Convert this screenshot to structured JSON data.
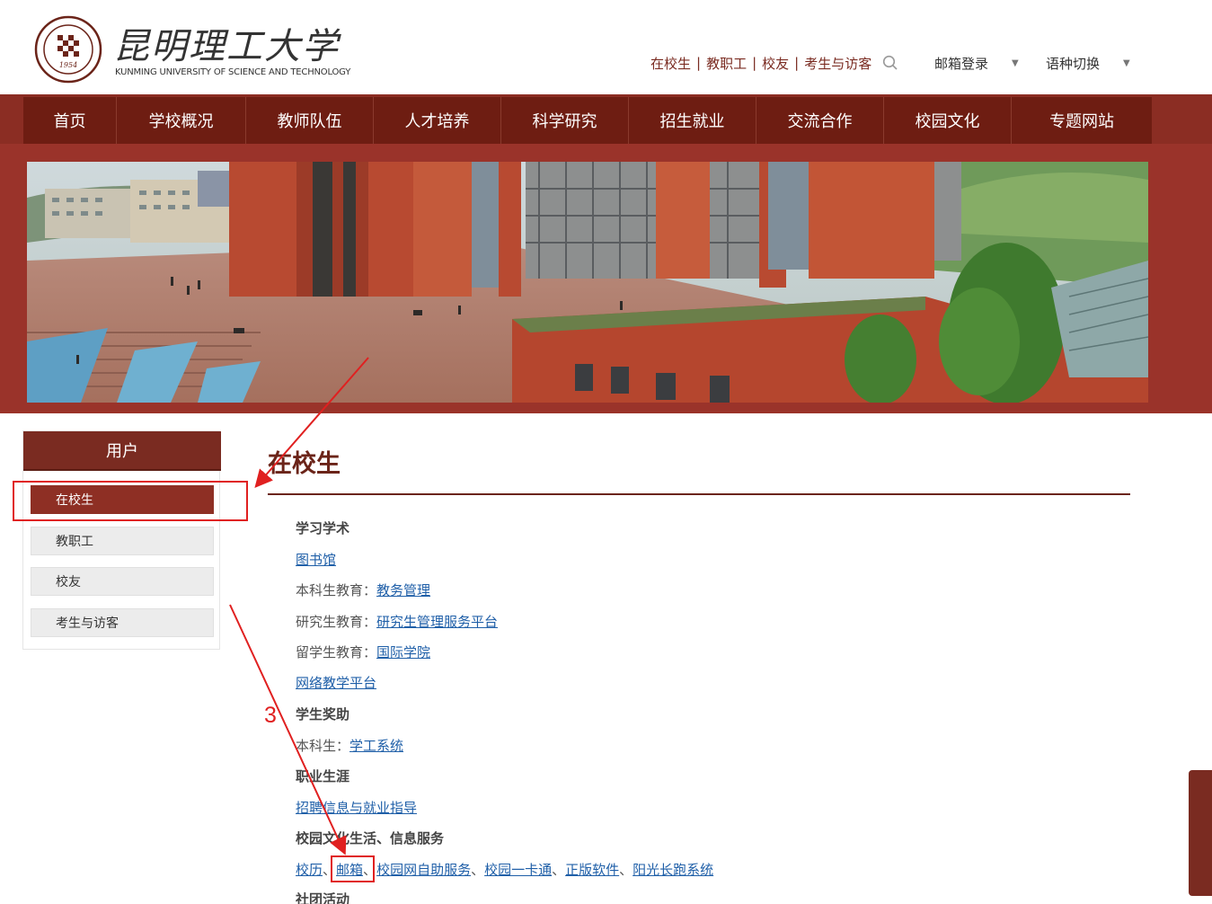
{
  "header": {
    "logo_cn": "昆明理工大学",
    "logo_en": "KUNMING UNIVERSITY OF SCIENCE AND TECHNOLOGY",
    "seal_year": "1954",
    "links": [
      "在校生",
      "教职工",
      "校友",
      "考生与访客"
    ],
    "link_separator": "|",
    "search_icon": "search-icon",
    "mail_login": "邮箱登录",
    "language_switch": "语种切换",
    "caret": "▼"
  },
  "nav": {
    "items": [
      "首页",
      "学校概况",
      "教师队伍",
      "人才培养",
      "科学研究",
      "招生就业",
      "交流合作",
      "校园文化",
      "专题网站"
    ]
  },
  "sidebar": {
    "title": "用户",
    "items": [
      "在校生",
      "教职工",
      "校友",
      "考生与访客"
    ],
    "active_index": 0
  },
  "content": {
    "title": "在校生",
    "sections": {
      "study_head": "学习学术",
      "library": "图书馆",
      "undergrad_label": "本科生教育：",
      "undergrad_link": "教务管理",
      "grad_label": "研究生教育：",
      "grad_link": "研究生管理服务平台",
      "intl_label": "留学生教育：",
      "intl_link": "国际学院",
      "online_link": "网络教学平台",
      "aid_head": "学生奖助",
      "aid_label": "本科生：",
      "aid_link": "学工系统",
      "career_head": "职业生涯",
      "career_link": "招聘信息与就业指导",
      "life_head": "校园文化生活、信息服务",
      "life_links": [
        "校历",
        "邮箱",
        "校园网自助服务",
        "校园一卡通",
        "正版软件",
        "阳光长跑系统"
      ],
      "life_sep": "、",
      "club_head": "社团活动"
    }
  },
  "annotation": {
    "step_number": "3",
    "color": "#e02020"
  },
  "colors": {
    "brand": "#7a2b21",
    "nav_bg": "#6e1d12",
    "link": "#1f5fa8"
  }
}
